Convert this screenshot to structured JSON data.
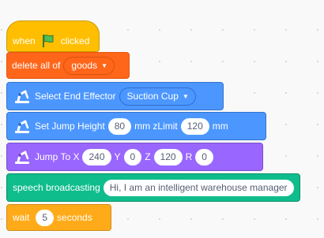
{
  "blocks": {
    "when_clicked": {
      "prefix": "when",
      "icon": "green-flag-icon",
      "suffix": "clicked"
    },
    "delete_all": {
      "label": "delete all of",
      "list_value": "goods"
    },
    "select_effector": {
      "label": "Select End Effector",
      "value": "Suction Cup"
    },
    "jump_height": {
      "label": "Set Jump Height",
      "height": "80",
      "zlimit_label": "mm zLimit",
      "zlimit": "120",
      "unit": "mm"
    },
    "jump_to": {
      "label": "Jump To X",
      "x": "240",
      "y_label": "Y",
      "y": "0",
      "z_label": "Z",
      "z": "120",
      "r_label": "R",
      "r": "0"
    },
    "speech": {
      "label": "speech broadcasting",
      "text": "Hi, I am an intelligent warehouse manager"
    },
    "wait": {
      "label": "wait",
      "seconds": "5",
      "unit": "seconds"
    }
  },
  "colors": {
    "events": "#ffbf00",
    "data": "#ff661a",
    "robot": "#4c97ff",
    "move": "#9966ff",
    "speech": "#0fbd8c",
    "control": "#ffab19"
  }
}
